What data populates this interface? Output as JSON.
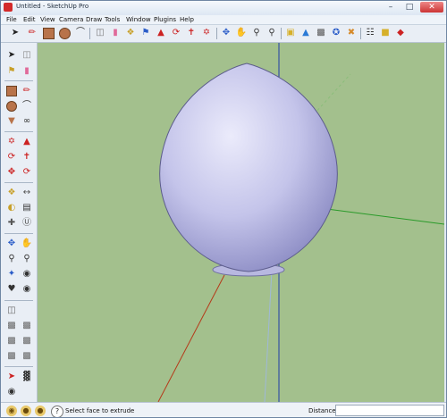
{
  "window": {
    "title": "Untitled - SketchUp Pro"
  },
  "menu": {
    "items": [
      "File",
      "Edit",
      "View",
      "Camera",
      "Draw",
      "Tools",
      "Window",
      "Plugins",
      "Help"
    ]
  },
  "toolbar_icons": [
    "select-icon",
    "line-icon",
    "rectangle-icon",
    "circle-icon",
    "arc-icon",
    "make-component-icon",
    "eraser-icon",
    "tape-measure-icon",
    "paint-bucket-icon",
    "push-pull-icon",
    "rotate-icon",
    "follow-me-icon",
    "move-icon",
    "scale-icon",
    "orbit-icon",
    "zoom-icon",
    "zoom-extents-icon",
    "get-models-icon",
    "share-model-icon",
    "components-icon",
    "extension-warehouse-icon",
    "photo-textures-icon",
    "layer-icon",
    "send-to-layout-icon"
  ],
  "status": {
    "message": "Select face to extrude",
    "measure_label": "Distance",
    "measure_value": ""
  },
  "colors": {
    "ground": "#a3c08d",
    "model": "#bdbde6",
    "axis_red": "#b53a1a",
    "axis_green": "#2a9a2a",
    "axis_blue": "#1f3ba8"
  }
}
